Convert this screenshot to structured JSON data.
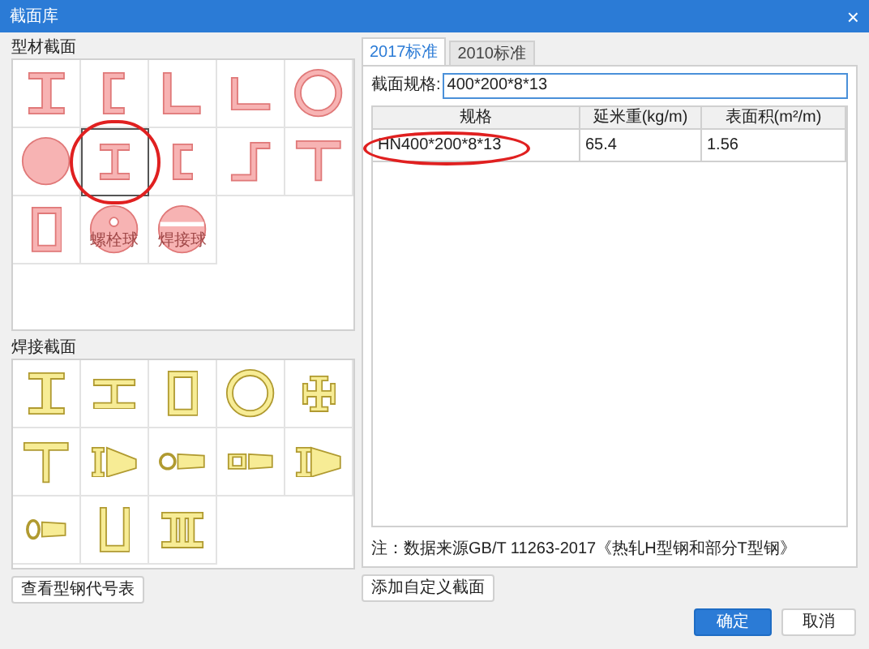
{
  "window": {
    "title": "截面库",
    "close": "×"
  },
  "rolled_sections": {
    "title": "型材截面",
    "items": [
      {
        "kind": "i_beam",
        "selected": false,
        "circled": false
      },
      {
        "kind": "channel",
        "selected": false,
        "circled": false
      },
      {
        "kind": "angle",
        "selected": false,
        "circled": false
      },
      {
        "kind": "angle_small",
        "selected": false,
        "circled": false
      },
      {
        "kind": "pipe",
        "selected": false,
        "circled": false
      },
      {
        "kind": "round_bar",
        "selected": false,
        "circled": false
      },
      {
        "kind": "i_beam_small",
        "selected": true,
        "circled": true
      },
      {
        "kind": "channel_small",
        "selected": false,
        "circled": false
      },
      {
        "kind": "z_section",
        "selected": false,
        "circled": false
      },
      {
        "kind": "tee",
        "selected": false,
        "circled": false
      },
      {
        "kind": "box",
        "selected": false,
        "circled": false
      },
      {
        "kind": "bolt_ball",
        "label": "螺栓球",
        "selected": false,
        "circled": false
      },
      {
        "kind": "weld_ball",
        "label": "焊接球",
        "selected": false,
        "circled": false
      }
    ]
  },
  "welded_sections": {
    "title": "焊接截面",
    "items": [
      {
        "kind": "i_beam",
        "selected": false
      },
      {
        "kind": "i_beam_wide",
        "selected": false
      },
      {
        "kind": "box",
        "selected": false
      },
      {
        "kind": "pipe",
        "selected": false
      },
      {
        "kind": "cross",
        "selected": false
      },
      {
        "kind": "tee",
        "selected": false
      },
      {
        "kind": "i_tapered",
        "selected": false
      },
      {
        "kind": "circle_tapered",
        "selected": false
      },
      {
        "kind": "box_tapered",
        "selected": false
      },
      {
        "kind": "tapered_i",
        "selected": false
      },
      {
        "kind": "circle_tapered_small",
        "selected": false
      },
      {
        "kind": "u_section",
        "selected": false
      },
      {
        "kind": "double_i",
        "selected": false
      }
    ]
  },
  "code_table_button": "查看型钢代号表",
  "tabs": [
    {
      "label": "2017标准",
      "selected": true
    },
    {
      "label": "2010标准",
      "selected": false
    }
  ],
  "spec_field": {
    "label": "截面规格:",
    "value": "400*200*8*13"
  },
  "table": {
    "columns": [
      "规格",
      "延米重(kg/m)",
      "表面积(m²/m)"
    ],
    "rows": [
      {
        "cells": [
          "HN400*200*8*13",
          "65.4",
          "1.56"
        ],
        "circled": true
      }
    ]
  },
  "note": "注：数据来源GB/T 11263-2017《热轧H型钢和部分T型钢》",
  "custom_button": "添加自定义截面",
  "buttons": [
    {
      "label": "确定",
      "primary": true
    },
    {
      "label": "取消",
      "primary": false
    }
  ]
}
